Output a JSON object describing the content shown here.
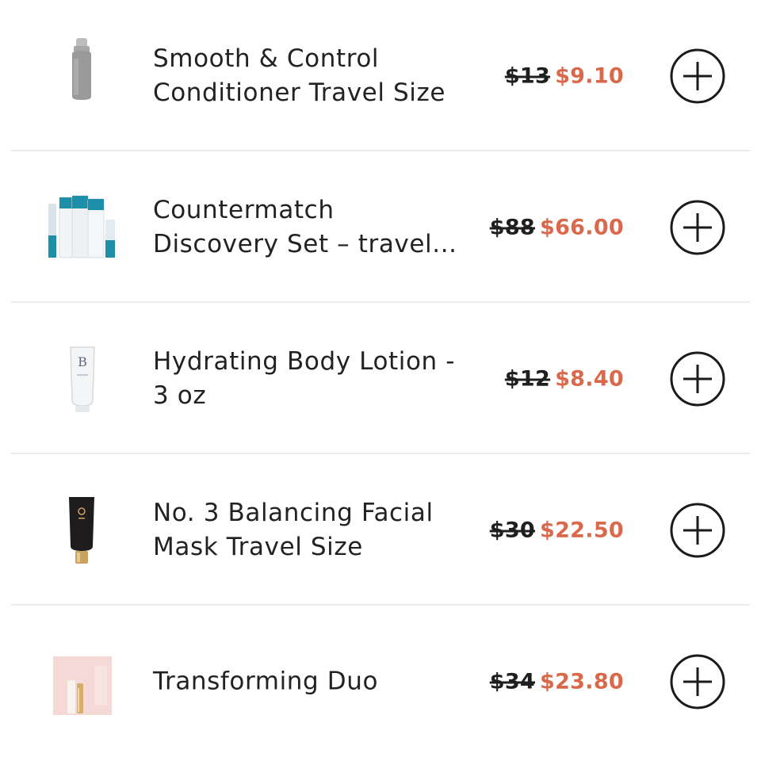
{
  "products": [
    {
      "name": "Smooth & Control\nConditioner Travel Size",
      "original_price": "$13",
      "sale_price": "$9.10",
      "image_icon": "conditioner-bottle"
    },
    {
      "name": "Countermatch\nDiscovery Set – travel...",
      "original_price": "$88",
      "sale_price": "$66.00",
      "image_icon": "discovery-set"
    },
    {
      "name": "Hydrating Body Lotion -\n3 oz",
      "original_price": "$12",
      "sale_price": "$8.40",
      "image_icon": "lotion-tube"
    },
    {
      "name": "No. 3 Balancing Facial\nMask Travel Size",
      "original_price": "$30",
      "sale_price": "$22.50",
      "image_icon": "mask-tube"
    },
    {
      "name": "Transforming Duo",
      "original_price": "$34",
      "sale_price": "$23.80",
      "image_icon": "duo-box"
    }
  ],
  "colors": {
    "sale_price": "#d9694a",
    "original_price": "#1f1f1f",
    "text": "#222222",
    "divider": "#ededed"
  },
  "icons": {
    "add_button": "plus-circle-icon"
  }
}
